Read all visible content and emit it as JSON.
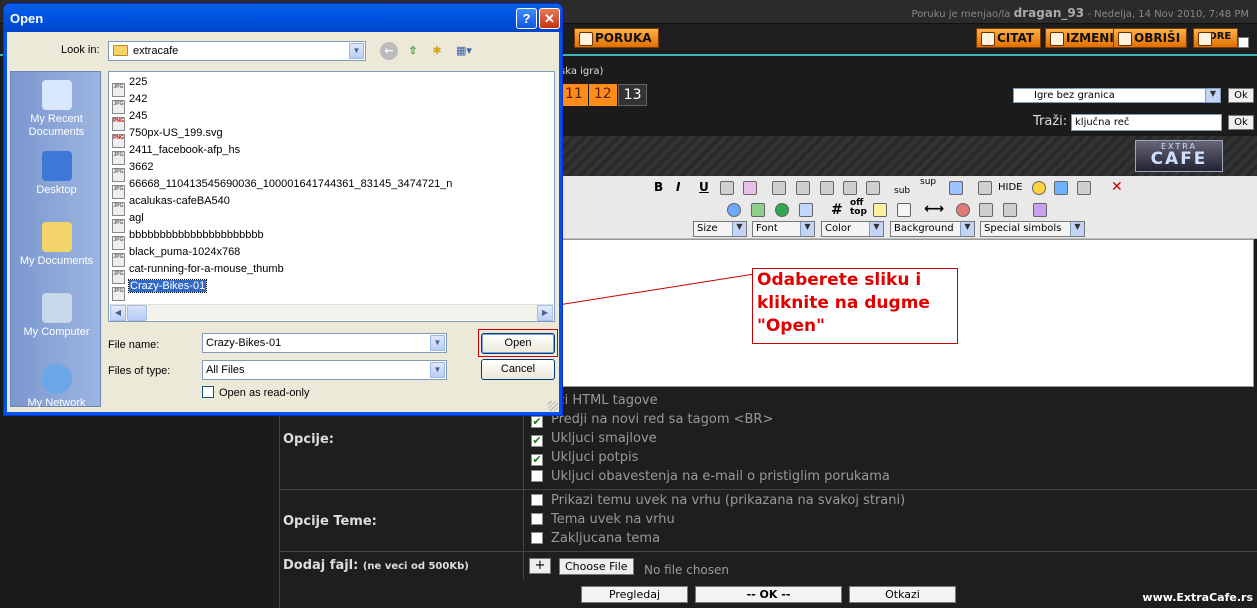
{
  "forum": {
    "top_info_prefix": "Poruku je menjao/la",
    "top_info_user": "dragan_93",
    "top_info_date": "- Nedelja, 14 Nov 2010, 7:48 PM",
    "btn_poruka": "PORUKA",
    "btn_citat": "CITAT",
    "btn_izmeni": "IZMENI",
    "btn_obrisi": "OBRIŠI",
    "btn_gore": "GORE",
    "subtitle": "ska igra)",
    "pages": [
      "11",
      "12",
      "13"
    ],
    "current_page": "13",
    "forum_select": "Igre bez granica",
    "ok_label": "Ok",
    "trazi_label": "Traži:",
    "trazi_value": "ključna reč",
    "logo_top": "EXTRA",
    "logo_bottom": "CAFE",
    "toolbar": {
      "sub": "sub",
      "sup": "sup",
      "hide": "HIDE",
      "hash": "#",
      "offtop_1": "off",
      "offtop_2": "top",
      "size": "Size",
      "font": "Font",
      "color": "Color",
      "background": "Background",
      "special": "Special simbols"
    },
    "callout": "Odaberete sliku i kliknite na dugme \"Open\"",
    "opcije_label": "Opcije:",
    "opcije": [
      {
        "label": "ljuci HTML tagove",
        "checked": false
      },
      {
        "label": "Predji na novi red sa tagom <BR>",
        "checked": true
      },
      {
        "label": "Ukljuci smajlove",
        "checked": true
      },
      {
        "label": "Ukljuci potpis",
        "checked": true
      },
      {
        "label": "Ukljuci obavestenja na e-mail o pristiglim porukama",
        "checked": false
      }
    ],
    "opcije_teme_label": "Opcije Teme:",
    "opcije_teme": [
      {
        "label": "Prikazi temu uvek na vrhu (prikazana na svakoj strani)",
        "checked": false
      },
      {
        "label": "Tema uvek na vrhu",
        "checked": false
      },
      {
        "label": "Zakljucana tema",
        "checked": false
      }
    ],
    "dodaj_label": "Dodaj fajl:",
    "dodaj_note": "(ne veci od 500Kb)",
    "plus": "+",
    "choose_file": "Choose File",
    "no_file": "No file chosen",
    "btn_pregledaj": "Pregledaj",
    "btn_ok": "-- OK --",
    "btn_otkazi": "Otkazi",
    "site": "www.ExtraCafe.rs"
  },
  "dialog": {
    "title": "Open",
    "help": "?",
    "close": "✕",
    "look_in_label": "Look in:",
    "look_in_value": "extracafe",
    "places": [
      "My Recent Documents",
      "Desktop",
      "My Documents",
      "My Computer",
      "My Network"
    ],
    "files": [
      {
        "name": "225",
        "type": "JPG"
      },
      {
        "name": "242",
        "type": "JPG"
      },
      {
        "name": "245",
        "type": "PNG"
      },
      {
        "name": "750px-US_199.svg",
        "type": "PNG"
      },
      {
        "name": "2411_facebook-afp_hs",
        "type": "JPG"
      },
      {
        "name": "3662",
        "type": "JPG"
      },
      {
        "name": "66668_110413545690036_100001641744361_83145_3474721_n",
        "type": "JPG"
      },
      {
        "name": "acalukas-cafeBA540",
        "type": "JPG"
      },
      {
        "name": "agl",
        "type": "JPG"
      },
      {
        "name": "bbbbbbbbbbbbbbbbbbbbbb",
        "type": "JPG"
      },
      {
        "name": "black_puma-1024x768",
        "type": "JPG"
      },
      {
        "name": "cat-running-for-a-mouse_thumb",
        "type": "JPG"
      },
      {
        "name": "Crazy-Bikes-01",
        "type": "JPG"
      }
    ],
    "selected_file": "Crazy-Bikes-01",
    "file_name_label": "File name:",
    "file_name_value": "Crazy-Bikes-01",
    "files_of_type_label": "Files of type:",
    "files_of_type_value": "All Files",
    "open_button": "Open",
    "cancel_button": "Cancel",
    "readonly_label": "Open as read-only"
  }
}
